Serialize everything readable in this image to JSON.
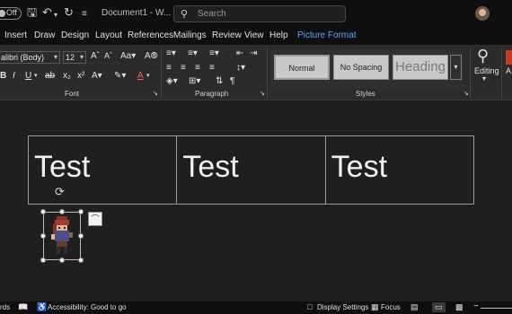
{
  "titlebar": {
    "autosave_label": "Off",
    "document_title": "Document1 - W...",
    "search_placeholder": "Search",
    "icons": [
      "save-icon",
      "undo-icon",
      "redo-icon",
      "customize-icon",
      "search-icon",
      "avatar"
    ]
  },
  "tabs": [
    {
      "label": "Insert"
    },
    {
      "label": "Draw"
    },
    {
      "label": "Design"
    },
    {
      "label": "Layout"
    },
    {
      "label": "References"
    },
    {
      "label": "Mailings"
    },
    {
      "label": "Review"
    },
    {
      "label": "View"
    },
    {
      "label": "Help"
    },
    {
      "label": "Picture Format",
      "active": true
    }
  ],
  "ribbon": {
    "font_name": "alibri (Body)",
    "font_size": "12",
    "groups": {
      "font": "Font",
      "paragraph": "Paragraph",
      "styles": "Styles"
    },
    "styles": [
      {
        "label": "Normal"
      },
      {
        "label": "No Spacing"
      },
      {
        "label": "Heading"
      }
    ],
    "editing_label": "Editing",
    "cut_label": "A"
  },
  "document": {
    "table_cells": [
      "Test",
      "Test",
      "Test"
    ]
  },
  "statusbar": {
    "left_text": "rds",
    "accessibility": "Accessibility: Good to go",
    "display_settings": "Display Settings",
    "focus": "Focus"
  },
  "colors": {
    "accent": "#5fa8ff",
    "background": "#1f1f1f",
    "titlebar": "#0f0f0f",
    "ribbon": "#2b2b2b"
  }
}
